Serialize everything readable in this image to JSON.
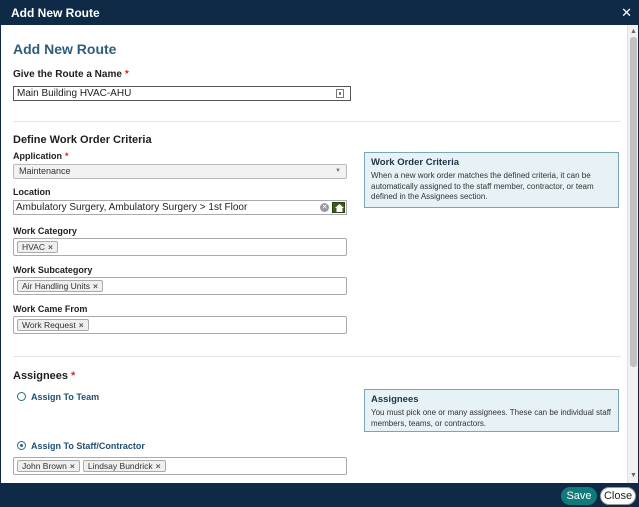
{
  "window": {
    "title": "Add New Route",
    "close_icon": "close-icon"
  },
  "page": {
    "title": "Add New Route"
  },
  "route_name": {
    "label": "Give the Route a Name",
    "required_mark": "*",
    "value": "Main Building HVAC-AHU"
  },
  "criteria": {
    "section_title": "Define Work Order Criteria",
    "application": {
      "label": "Application",
      "required_mark": "*",
      "value": "Maintenance"
    },
    "location": {
      "label": "Location",
      "value": "Ambulatory Surgery, Ambulatory Surgery > 1st Floor"
    },
    "work_category": {
      "label": "Work Category",
      "tags": [
        "HVAC"
      ]
    },
    "work_subcategory": {
      "label": "Work Subcategory",
      "tags": [
        "Air Handling Units"
      ]
    },
    "work_came_from": {
      "label": "Work Came From",
      "tags": [
        "Work Request"
      ]
    },
    "info": {
      "title": "Work Order Criteria",
      "text": "When a new work order matches the defined criteria, it can be automatically assigned to the staff member, contractor, or team defined in the Assignees section."
    }
  },
  "assignees": {
    "section_title": "Assignees",
    "required_mark": "*",
    "assign_to_team": {
      "label": "Assign To Team",
      "checked": false
    },
    "assign_to_staff": {
      "label": "Assign To Staff/Contractor",
      "checked": true,
      "tags": [
        "John Brown",
        "Lindsay Bundrick"
      ]
    },
    "info": {
      "title": "Assignees",
      "text": "You must pick one or many assignees. These can be individual staff members, teams, or contractors."
    }
  },
  "footer": {
    "save_label": "Save",
    "close_label": "Close"
  },
  "colors": {
    "header_bg": "#0e2a47",
    "accent": "#117a7a",
    "title_blue": "#2f5d7c",
    "required": "#d9261c",
    "info_bg": "#e6f2f6"
  }
}
